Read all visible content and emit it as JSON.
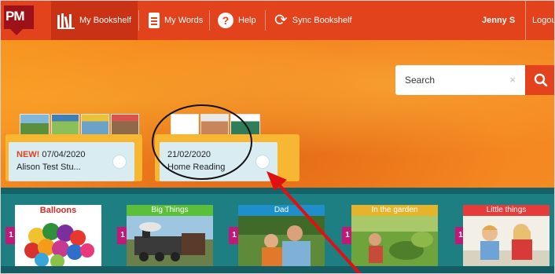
{
  "app": {
    "logo_text": "PM"
  },
  "nav": {
    "bookshelf_label": "My Bookshelf",
    "words_label": "My Words",
    "help_label": "Help",
    "sync_label": "Sync Bookshelf",
    "user_name": "Jenny S",
    "logout_label": "Logout"
  },
  "search": {
    "value": "Search",
    "clear_symbol": "×"
  },
  "bookshelves": [
    {
      "new_label": "NEW!",
      "date": "07/04/2020",
      "title": "Alison Test Stu..."
    },
    {
      "date": "21/02/2020",
      "title": "Home Reading"
    }
  ],
  "books": [
    {
      "label": "Balloons",
      "count": "1",
      "label_color": "#ffffff"
    },
    {
      "label": "Big Things",
      "count": "1",
      "label_color": "#5cbf3a"
    },
    {
      "label": "Dad",
      "count": "1",
      "label_color": "#1e8fcb"
    },
    {
      "label": "In the garden",
      "count": "1",
      "label_color": "#e6b42a"
    },
    {
      "label": "Little things",
      "count": "1",
      "label_color": "#e63b3b"
    }
  ],
  "colors": {
    "brand_red": "#e2421c",
    "banner_orange": "#f37c1e",
    "teal": "#1e7f83",
    "badge_magenta": "#c2187a",
    "annotation_arrow": "#e01010"
  },
  "icons": [
    "bookshelf-icon",
    "notepad-icon",
    "help-icon",
    "sync-icon",
    "search-icon",
    "clear-icon"
  ]
}
